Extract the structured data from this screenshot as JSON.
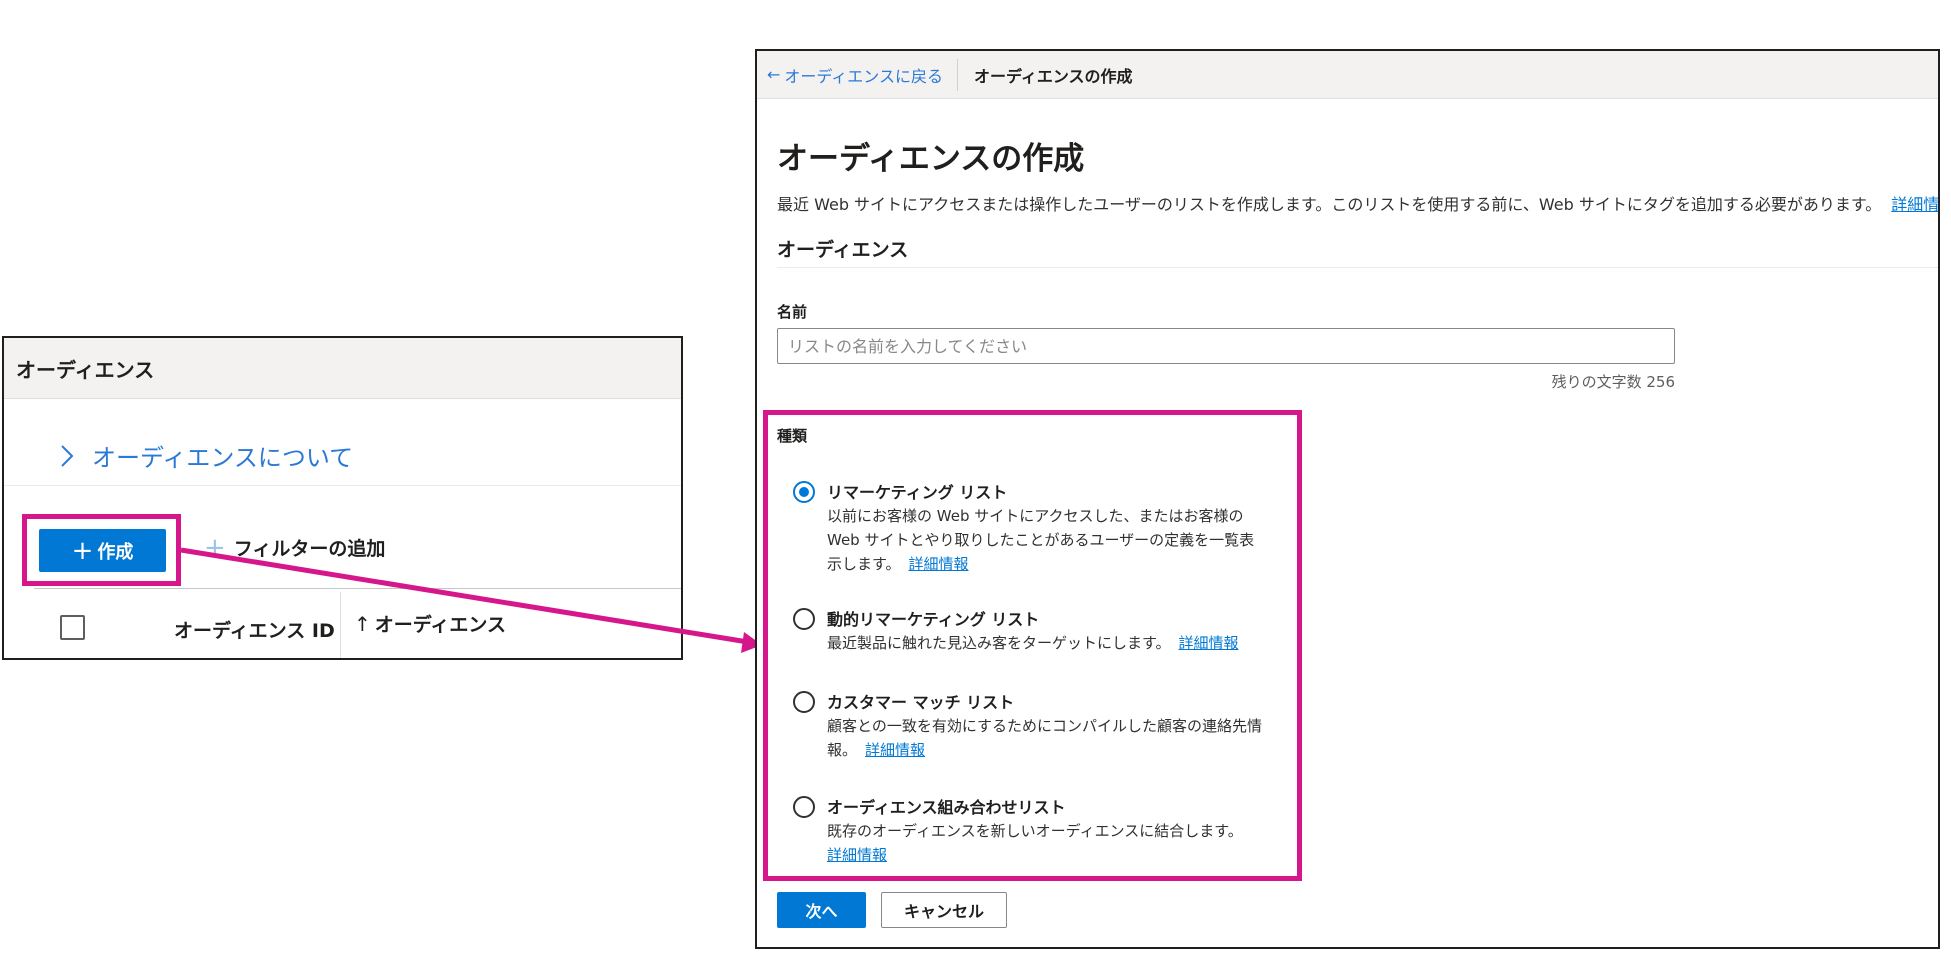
{
  "left_panel": {
    "title": "オーディエンス",
    "about_link": "オーディエンスについて",
    "create_button": "作成",
    "create_icon": "plus-icon",
    "filter_add": "フィルターの追加",
    "columns": {
      "id": "オーディエンス ID",
      "audience": "オーディエンス"
    }
  },
  "right_panel": {
    "header": {
      "back_link": "オーディエンスに戻る",
      "breadcrumb": "オーディエンスの作成"
    },
    "title": "オーディエンスの作成",
    "description": "最近 Web サイトにアクセスまたは操作したユーザーのリストを作成します。このリストを使用する前に、Web サイトにタグを追加する必要があります。",
    "description_link": "詳細情報",
    "section_title": "オーディエンス",
    "name": {
      "label": "名前",
      "placeholder": "リストの名前を入力してください",
      "remaining": "残りの文字数 256"
    },
    "type": {
      "label": "種類",
      "selected": "remarketing",
      "options": [
        {
          "title": "リマーケティング リスト",
          "description": "以前にお客様の Web サイトにアクセスした、またはお客様の Web サイトとやり取りしたことがあるユーザーの定義を一覧表示します。",
          "link": "詳細情報"
        },
        {
          "title": "動的リマーケティング リスト",
          "description": "最近製品に触れた見込み客をターゲットにします。",
          "link": "詳細情報"
        },
        {
          "title": "カスタマー マッチ リスト",
          "description": "顧客との一致を有効にするためにコンパイルした顧客の連絡先情報。",
          "link": "詳細情報"
        },
        {
          "title": "オーディエンス組み合わせリスト",
          "description": "既存のオーディエンスを新しいオーディエンスに結合します。",
          "link": "詳細情報"
        }
      ]
    },
    "buttons": {
      "next": "次へ",
      "cancel": "キャンセル"
    }
  },
  "colors": {
    "accent": "#0078d4",
    "highlight": "#d6178c",
    "link": "#2b79d6"
  }
}
